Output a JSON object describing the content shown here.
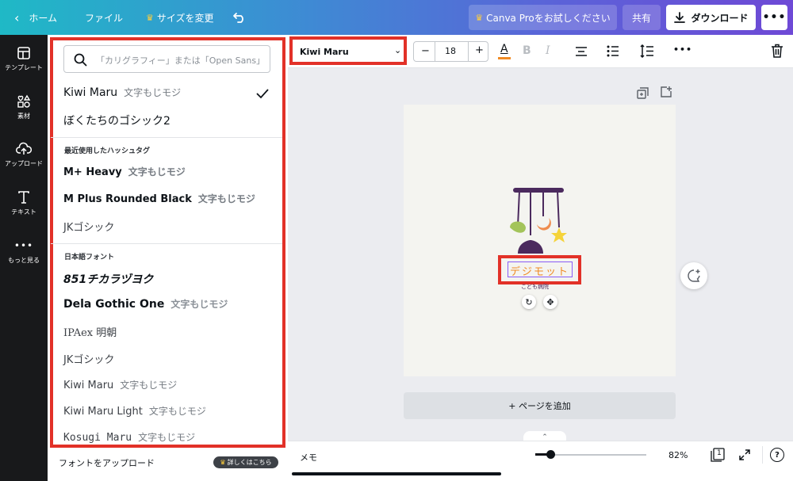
{
  "topbar": {
    "home": "ホーム",
    "file": "ファイル",
    "resize": "サイズを変更",
    "try_pro": "Canva Proをお試しください",
    "share": "共有",
    "download": "ダウンロード",
    "gradient_colors": [
      "#1fb9c6",
      "#5b63d8",
      "#6e49d6"
    ]
  },
  "sidebar": {
    "items": [
      {
        "label": "テンプレート",
        "icon": "template-icon"
      },
      {
        "label": "素材",
        "icon": "elements-icon"
      },
      {
        "label": "アップロード",
        "icon": "upload-icon"
      },
      {
        "label": "テキスト",
        "icon": "text-icon"
      },
      {
        "label": "もっと見る",
        "icon": "more-icon"
      }
    ]
  },
  "font_panel": {
    "search_placeholder": "「カリグラフィー」または「Open Sans」",
    "current_fonts": [
      {
        "name": "Kiwi Maru",
        "sample": "文字もじモジ",
        "selected": true
      },
      {
        "name": "ぼくたちのゴシック2",
        "sample": "",
        "selected": false
      }
    ],
    "recent_heading": "最近使用したハッシュタグ",
    "recent_fonts": [
      {
        "name": "M+ Heavy",
        "sample": "文字もじモジ"
      },
      {
        "name": "M Plus Rounded Black",
        "sample": "文字もじモジ"
      },
      {
        "name": "JKゴシック",
        "sample": ""
      }
    ],
    "japanese_heading": "日本語フォント",
    "japanese_fonts": [
      {
        "name": "851チカラヅヨク",
        "sample": ""
      },
      {
        "name": "Dela Gothic One",
        "sample": "文字もじモジ"
      },
      {
        "name": "IPAex 明朝",
        "sample": ""
      },
      {
        "name": "JKゴシック",
        "sample": ""
      },
      {
        "name": "Kiwi Maru",
        "sample": "文字もじモジ"
      },
      {
        "name": "Kiwi Maru Light",
        "sample": "文字もじモジ"
      },
      {
        "name": "Kosugi Maru",
        "sample": "文字もじモジ"
      }
    ],
    "upload_label": "フォントをアップロード",
    "learn_more": "詳しくはこちら"
  },
  "toolbar": {
    "font_family": "Kiwi Maru",
    "font_size": "18",
    "decrease": "−",
    "increase": "+",
    "text_color_letter": "A",
    "text_color_swatch": "#f08a24",
    "bold": "B",
    "italic": "I",
    "more": "•••"
  },
  "canvas": {
    "title_text": "デジモット",
    "subtitle_text": "こども病院",
    "add_page": "+ ページを追加",
    "highlight_color": "#e23128"
  },
  "bottombar": {
    "notes": "メモ",
    "zoom": "82%",
    "page_number": "1",
    "help": "?"
  }
}
